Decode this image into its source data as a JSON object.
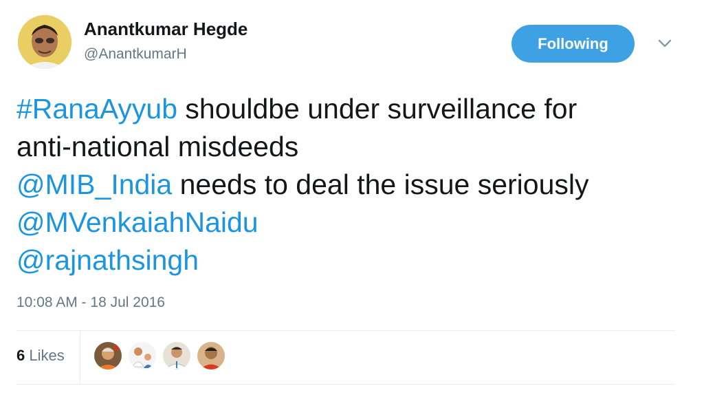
{
  "author": {
    "display_name": "Anantkumar Hegde",
    "handle": "@AnantkumarH",
    "avatar_icon": "user-avatar"
  },
  "follow_button": {
    "label": "Following",
    "color": "#3ea1e4"
  },
  "menu_icon": "chevron-down-icon",
  "tweet": {
    "line1_mention": "#RanaAyyub",
    "line1_text": " shouldbe under surveillance for",
    "line2_text": "anti-national misdeeds",
    "line3_mention": "@MIB_India",
    "line3_text": " needs to deal the issue seriously",
    "line4_mention": "@MVenkaiahNaidu",
    "line5_mention": "@rajnathsingh",
    "link_color": "#1b95e0"
  },
  "timestamp": "10:08 AM - 18 Jul 2016",
  "stats": {
    "likes_count": "6",
    "likes_label": " Likes"
  },
  "likers": [
    {
      "icon": "liker-avatar-1"
    },
    {
      "icon": "liker-avatar-2"
    },
    {
      "icon": "liker-avatar-3"
    },
    {
      "icon": "liker-avatar-4"
    }
  ]
}
